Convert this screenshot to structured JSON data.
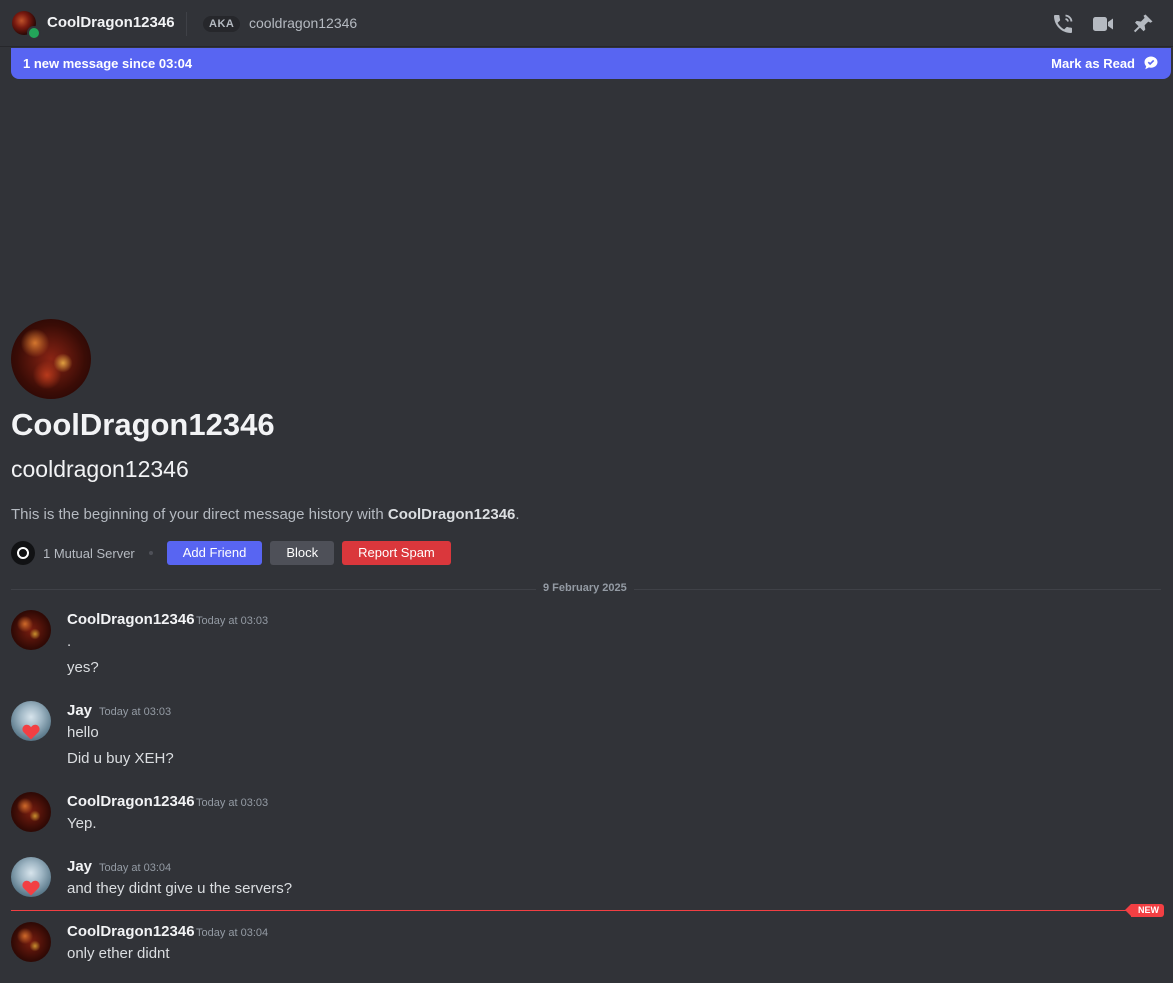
{
  "header": {
    "display_name": "CoolDragon12346",
    "aka_label": "AKA",
    "aka_name": "cooldragon12346",
    "icons": [
      "phone-call-icon",
      "video-call-icon",
      "pin-icon"
    ]
  },
  "banner": {
    "text": "1 new message since 03:04",
    "action_label": "Mark as Read",
    "action_icon": "mark-read-icon"
  },
  "profile": {
    "display_name": "CoolDragon12346",
    "username": "cooldragon12346",
    "intro_prefix": "This is the beginning of your direct message history with ",
    "intro_name": "CoolDragon12346",
    "intro_suffix": ".",
    "mutual_servers": "1 Mutual Server",
    "buttons": {
      "add_friend": "Add Friend",
      "block": "Block",
      "report_spam": "Report Spam"
    }
  },
  "date_divider": "9 February 2025",
  "messages": [
    {
      "author": "CoolDragon12346",
      "time": "Today at 03:03",
      "lines": [
        ".",
        "yes?"
      ]
    },
    {
      "author": "Jay",
      "time": "Today at 03:03",
      "lines": [
        "hello",
        "Did u buy XEH?"
      ]
    },
    {
      "author": "CoolDragon12346",
      "time": "Today at 03:03",
      "lines": [
        "Yep."
      ]
    },
    {
      "author": "Jay",
      "time": "Today at 03:04",
      "lines": [
        "and they didnt give u the servers?"
      ]
    },
    {
      "author": "CoolDragon12346",
      "time": "Today at 03:04",
      "lines": [
        "only ether didnt"
      ]
    }
  ],
  "new_marker": "NEW",
  "colors": {
    "background": "#313338",
    "accent": "#5865f2",
    "danger": "#da373c",
    "new_line": "#f23f43",
    "online": "#23a55a"
  }
}
